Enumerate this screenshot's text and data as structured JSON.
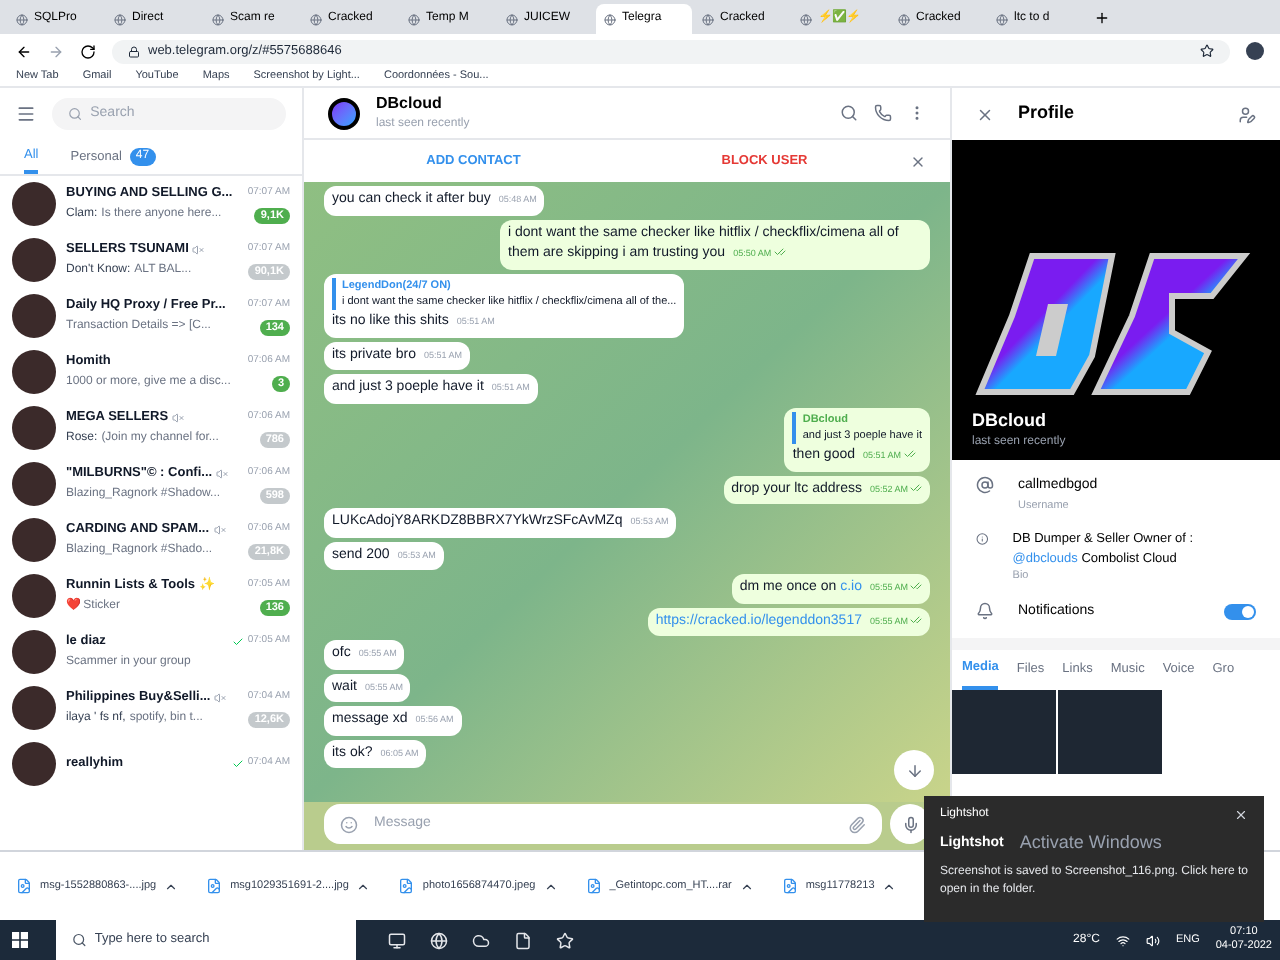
{
  "browser": {
    "tabs": [
      {
        "label": "SQLPro",
        "selected": false
      },
      {
        "label": "Direct",
        "selected": false
      },
      {
        "label": "Scam re",
        "selected": false
      },
      {
        "label": "Cracked",
        "selected": false
      },
      {
        "label": "Temp M",
        "selected": false
      },
      {
        "label": "JUICEW",
        "selected": false
      },
      {
        "label": "Telegra",
        "selected": true
      },
      {
        "label": "Cracked",
        "selected": false
      },
      {
        "label": "⚡✅⚡",
        "selected": false
      },
      {
        "label": "Cracked",
        "selected": false
      },
      {
        "label": "ltc to d",
        "selected": false
      }
    ],
    "url": "web.telegram.org/z/#5575688646",
    "bookmarks": [
      "New Tab",
      "Gmail",
      "YouTube",
      "Maps",
      "Screenshot by Light...",
      "Coordonnées - Sou..."
    ]
  },
  "sidebar": {
    "search": {
      "placeholder": "Search"
    },
    "folders": [
      {
        "label": "All",
        "selected": true
      },
      {
        "label": "Personal",
        "badge": "47",
        "selected": false
      }
    ],
    "chats": [
      {
        "name": "BUYING AND SELLING G...",
        "time": "07:07 AM",
        "sender": "Clam:",
        "preview": "Is there anyone here...",
        "badge": "9,1K",
        "muted": false,
        "read": false
      },
      {
        "name": "SELLERS TSUNAMI",
        "time": "07:07 AM",
        "sender": "Don't Know:",
        "preview": "ALT BAL...",
        "badge": "90,1K",
        "muted": true,
        "read": false
      },
      {
        "name": "Daily HQ Proxy / Free Pr...",
        "time": "07:07 AM",
        "preview": "Transaction Details => [C...",
        "badge": "134",
        "muted": false,
        "read": false
      },
      {
        "name": "Homith",
        "time": "07:06 AM",
        "preview": "1000 or more, give me a disc...",
        "badge": "3",
        "muted": false,
        "read": false
      },
      {
        "name": "MEGA SELLERS",
        "time": "07:06 AM",
        "sender": "Rose:",
        "preview": "(Join my channel for...",
        "badge": "786",
        "muted": true,
        "read": false
      },
      {
        "name": "\"MILBURNS\"© : Confi...",
        "time": "07:06 AM",
        "preview": "Blazing_Ragnork #Shadow...",
        "badge": "598",
        "muted": true,
        "read": false
      },
      {
        "name": "CARDING AND SPAM...",
        "time": "07:06 AM",
        "preview": "Blazing_Ragnork #Shado...",
        "badge": "21,8K",
        "muted": true,
        "read": false
      },
      {
        "name": "Runnin Lists & Tools ✨",
        "time": "07:05 AM",
        "preview": "❤️ Sticker",
        "badge": "136",
        "muted": false,
        "read": false
      },
      {
        "name": "le diaz",
        "time": "07:05 AM",
        "preview": "Scammer in your group",
        "muted": false,
        "read": true
      },
      {
        "name": "Philippines Buy&Selli...",
        "time": "07:04 AM",
        "sender": "ilaya ' fs nf,",
        "preview": "spotify, bin t...",
        "badge": "12,6K",
        "muted": true,
        "read": false
      },
      {
        "name": "reallyhim",
        "time": "07:04 AM",
        "muted": false,
        "read": true
      }
    ]
  },
  "chat": {
    "name": "DBcloud",
    "status": "last seen recently",
    "actions": {
      "add": "ADD CONTACT",
      "block": "BLOCK USER"
    },
    "messages": [
      {
        "kind": "in",
        "text": "you can check it after buy",
        "time": "05:48 AM"
      },
      {
        "kind": "out",
        "text": "i dont want the same checker like hitflix / checkflix/cimena all of them are skipping i am trusting you",
        "time": "05:50 AM",
        "read": true
      },
      {
        "kind": "in",
        "reply": {
          "author": "LegendDon(24/7 ON)",
          "text": "i dont want the same checker like hitflix / checkflix/cimena all of the..."
        },
        "text": "its no like this shits",
        "time": "05:51 AM"
      },
      {
        "kind": "in",
        "text": "its private bro",
        "time": "05:51 AM"
      },
      {
        "kind": "in",
        "text": "and just 3 poeple have it",
        "time": "05:51 AM"
      },
      {
        "kind": "out",
        "reply": {
          "author": "DBcloud",
          "text": "and just 3 poeple have it"
        },
        "text": "then good",
        "time": "05:51 AM",
        "read": true
      },
      {
        "kind": "out",
        "text": "drop your ltc address",
        "time": "05:52 AM",
        "read": true
      },
      {
        "kind": "in",
        "text": "LUKcAdojY8ARKDZ8BBRX7YkWrzSFcAvMZq",
        "time": "05:53 AM"
      },
      {
        "kind": "in",
        "text": "send 200",
        "time": "05:53 AM"
      },
      {
        "kind": "out",
        "text": "dm me once on",
        "link": "c.io",
        "time": "05:55 AM",
        "read": true
      },
      {
        "kind": "out",
        "link": "https://cracked.io/legenddon3517",
        "time": "05:55 AM",
        "read": true
      },
      {
        "kind": "in",
        "text": "ofc",
        "time": "05:55 AM"
      },
      {
        "kind": "in",
        "text": "wait",
        "time": "05:55 AM"
      },
      {
        "kind": "in",
        "text": "message xd",
        "time": "05:56 AM"
      },
      {
        "kind": "in",
        "text": "its ok?",
        "time": "06:05 AM"
      }
    ],
    "composer": {
      "placeholder": "Message"
    }
  },
  "profile": {
    "title": "Profile",
    "name": "DBcloud",
    "status": "last seen recently",
    "username": {
      "value": "callmedbgod",
      "label": "Username"
    },
    "bio": {
      "text": "DB Dumper & Seller Owner of :",
      "link": "@dbclouds",
      "rest": "Combolist Cloud",
      "label": "Bio"
    },
    "notifications": {
      "label": "Notifications",
      "on": true
    },
    "tabs": [
      {
        "label": "Media",
        "selected": true
      },
      {
        "label": "Files",
        "selected": false
      },
      {
        "label": "Links",
        "selected": false
      },
      {
        "label": "Music",
        "selected": false
      },
      {
        "label": "Voice",
        "selected": false
      },
      {
        "label": "Gro",
        "selected": false
      }
    ]
  },
  "downloads": [
    "msg-1552880863-....jpg",
    "msg1029351691-2....jpg",
    "photo1656874470.jpeg",
    "_Getintopc.com_HT....rar",
    "msg11778213"
  ],
  "toast": {
    "app": "Lightshot",
    "title": "Lightshot",
    "overlay": "Activate Windows",
    "text": "Screenshot is saved to Screenshot_116.png. Click here to open in the folder."
  },
  "taskbar": {
    "search": {
      "placeholder": "Type here to search"
    },
    "weather": "28°C",
    "language": "ENG",
    "time": "07:10",
    "date": "04-07-2022"
  }
}
